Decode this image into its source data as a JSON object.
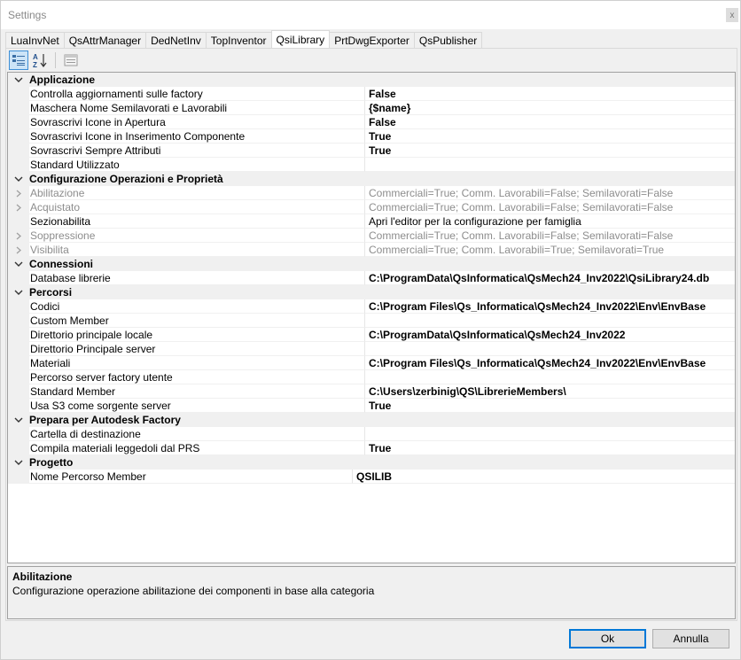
{
  "window": {
    "title": "Settings",
    "close_label": "x"
  },
  "tabs": [
    "LuaInvNet",
    "QsAttrManager",
    "DedNetInv",
    "TopInventor",
    "QsiLibrary",
    "PrtDwgExporter",
    "QsPublisher"
  ],
  "active_tab": "QsiLibrary",
  "toolbar": {
    "categorized": "categorized-icon",
    "alphabetical": "sort-az-icon",
    "property_pages": "property-pages-icon"
  },
  "grid": {
    "categories": [
      {
        "name": "Applicazione",
        "rows": [
          {
            "name": "Controlla aggiornamenti sulle factory",
            "value": "False"
          },
          {
            "name": "Maschera Nome Semilavorati e Lavorabili",
            "value": "{$name}"
          },
          {
            "name": "Sovrascrivi Icone in Apertura",
            "value": "False"
          },
          {
            "name": "Sovrascrivi Icone in Inserimento Componente",
            "value": "True"
          },
          {
            "name": "Sovrascrivi Sempre Attributi",
            "value": "True"
          },
          {
            "name": "Standard Utilizzato",
            "value": ""
          }
        ]
      },
      {
        "name": "Configurazione Operazioni e Proprietà",
        "rows": [
          {
            "name": "Abilitazione",
            "value": "Commerciali=True; Comm. Lavorabili=False; Semilavorati=False",
            "expandable": true
          },
          {
            "name": "Acquistato",
            "value": "Commerciali=True; Comm. Lavorabili=False; Semilavorati=False",
            "expandable": true
          },
          {
            "name": "Sezionabilita",
            "value": "Apri l'editor per la configurazione per famiglia",
            "plain": true
          },
          {
            "name": "Soppressione",
            "value": "Commerciali=True; Comm. Lavorabili=False; Semilavorati=False",
            "expandable": true
          },
          {
            "name": "Visibilita",
            "value": "Commerciali=True; Comm. Lavorabili=True; Semilavorati=True",
            "expandable": true
          }
        ]
      },
      {
        "name": "Connessioni",
        "rows": [
          {
            "name": "Database librerie",
            "value": "C:\\ProgramData\\QsInformatica\\QsMech24_Inv2022\\QsiLibrary24.db"
          }
        ]
      },
      {
        "name": "Percorsi",
        "rows": [
          {
            "name": "Codici",
            "value": "C:\\Program Files\\Qs_Informatica\\QsMech24_Inv2022\\Env\\EnvBase"
          },
          {
            "name": "Custom Member",
            "value": ""
          },
          {
            "name": "Direttorio principale locale",
            "value": "C:\\ProgramData\\QsInformatica\\QsMech24_Inv2022"
          },
          {
            "name": "Direttorio Principale server",
            "value": ""
          },
          {
            "name": "Materiali",
            "value": "C:\\Program Files\\Qs_Informatica\\QsMech24_Inv2022\\Env\\EnvBase"
          },
          {
            "name": "Percorso server factory utente",
            "value": ""
          },
          {
            "name": "Standard Member",
            "value": "C:\\Users\\zerbinig\\QS\\LibrerieMembers\\"
          },
          {
            "name": "Usa S3 come sorgente server",
            "value": "True"
          }
        ]
      },
      {
        "name": "Prepara per Autodesk Factory",
        "rows": [
          {
            "name": "Cartella di destinazione",
            "value": ""
          },
          {
            "name": "Compila materiali leggedoli dal PRS",
            "value": "True"
          }
        ]
      },
      {
        "name": "Progetto",
        "rows": [
          {
            "name": "Nome Percorso Member",
            "value": "QSILIB",
            "narrow": true
          }
        ]
      }
    ]
  },
  "description": {
    "title": "Abilitazione",
    "text": "Configurazione operazione abilitazione dei componenti in base alla categoria"
  },
  "buttons": {
    "ok": "Ok",
    "cancel": "Annulla"
  }
}
